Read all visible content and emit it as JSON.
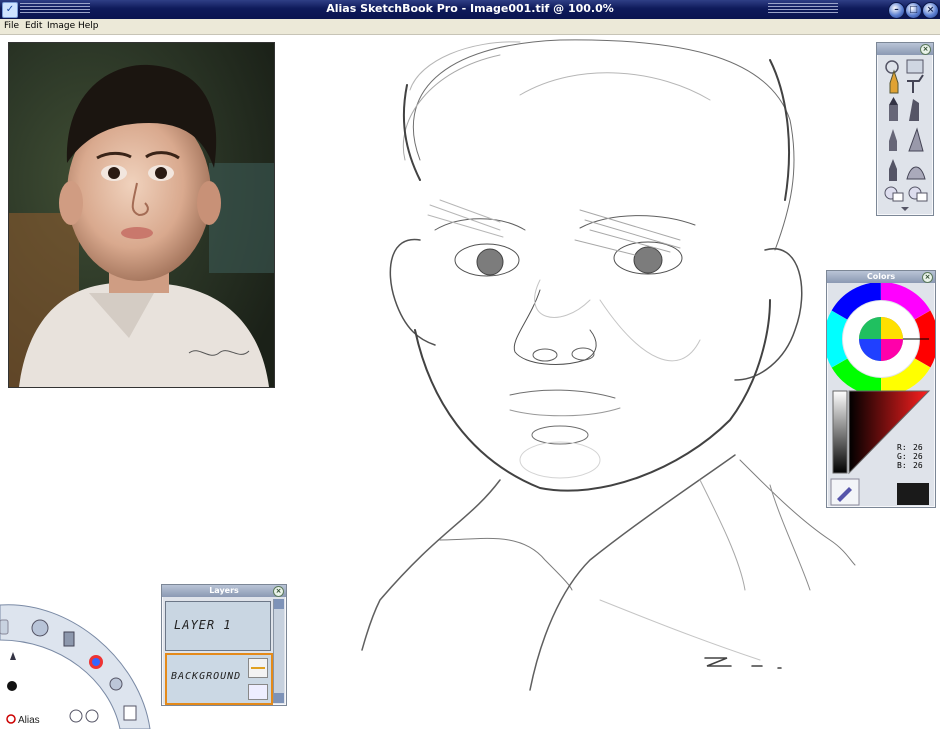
{
  "window": {
    "title": "Alias SketchBook Pro - Image001.tif @ 100.0%"
  },
  "menu": [
    {
      "label": "File"
    },
    {
      "label": "Edit"
    },
    {
      "label": "Image"
    },
    {
      "label": "Help"
    }
  ],
  "layers_panel": {
    "title": "Layers",
    "layers": [
      {
        "label": "LAYER 1"
      },
      {
        "label": "BACKGROUND"
      }
    ]
  },
  "colors_panel": {
    "title": "Colors",
    "rgb": {
      "r_label": "R:",
      "r": "26",
      "g_label": "G:",
      "g": "26",
      "b_label": "B:",
      "b": "26"
    },
    "current_color": "#1a1a1a"
  },
  "marking_menu": {
    "brand": "Alias"
  },
  "icons": [
    "pencil-icon",
    "airbrush-icon",
    "marker-icon",
    "pen-icon",
    "paintbrush-icon",
    "smudge-icon",
    "eraser-icon",
    "eyedropper-icon",
    "color-wheel-icon"
  ]
}
